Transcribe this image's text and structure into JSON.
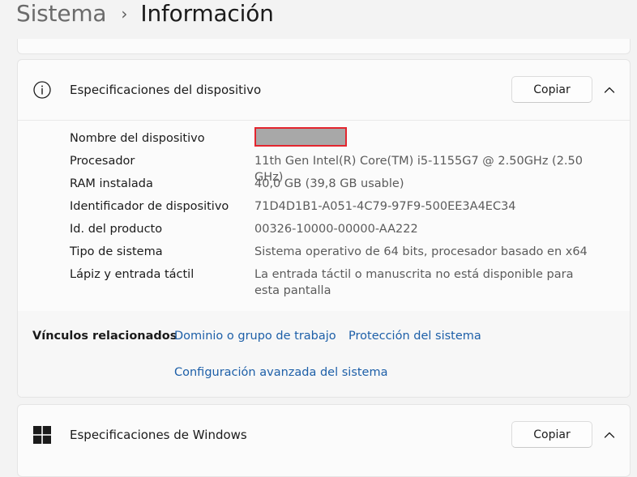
{
  "breadcrumb": {
    "parent": "Sistema",
    "separator": "›",
    "current": "Información"
  },
  "device_specs": {
    "title": "Especificaciones del dispositivo",
    "copy_label": "Copiar",
    "rows": [
      {
        "label": "Nombre del dispositivo",
        "value": ""
      },
      {
        "label": "Procesador",
        "value": "11th Gen Intel(R) Core(TM) i5-1155G7 @ 2.50GHz (2.50 GHz)"
      },
      {
        "label": "RAM instalada",
        "value": "40,0 GB (39,8 GB usable)"
      },
      {
        "label": "Identificador de dispositivo",
        "value": "71D4D1B1-A051-4C79-97F9-500EE3A4EC34"
      },
      {
        "label": "Id. del producto",
        "value": "00326-10000-00000-AA222"
      },
      {
        "label": "Tipo de sistema",
        "value": "Sistema operativo de 64 bits, procesador basado en x64"
      },
      {
        "label": "Lápiz y entrada táctil",
        "value": "La entrada táctil o manuscrita no está disponible para esta pantalla"
      }
    ]
  },
  "related_links": {
    "label": "Vínculos relacionados",
    "links": [
      "Dominio o grupo de trabajo",
      "Protección del sistema",
      "Configuración avanzada del sistema"
    ]
  },
  "windows_specs": {
    "title": "Especificaciones de Windows",
    "copy_label": "Copiar"
  },
  "colors": {
    "link": "#1d5fa8",
    "redaction_border": "#e3252e",
    "redaction_fill": "#a8a8a8"
  },
  "icons": {
    "device_card": "info-icon",
    "windows_card": "windows-logo-icon",
    "collapse": "chevron-up-icon"
  }
}
